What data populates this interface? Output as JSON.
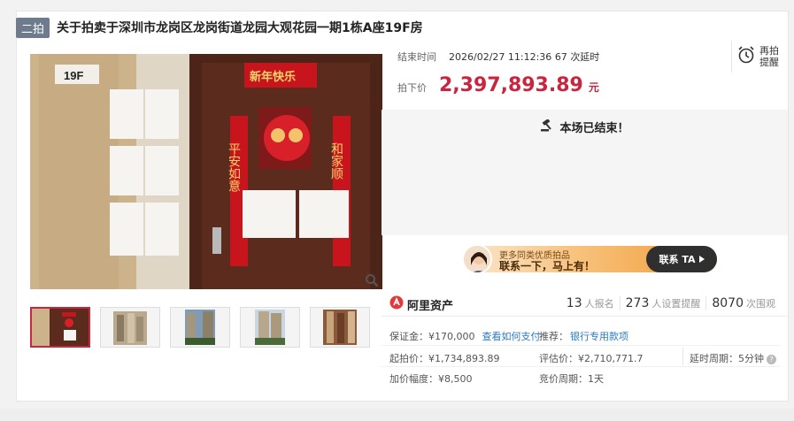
{
  "header": {
    "badge": "二拍",
    "title": "关于拍卖于深圳市龙岗区龙岗街道龙园大观花园一期1栋A座19F房"
  },
  "gallery": {
    "floor_sign": "19F",
    "couplet_top": "新年快乐",
    "couplet_left": "平安如意",
    "couplet_right": "和家顺",
    "thumbnail_count": 5
  },
  "auction": {
    "end_time_label": "结束时间",
    "end_time": "2026/02/27 11:12:36",
    "extensions": "67",
    "extensions_suffix": "次延时",
    "reminder_label": "再拍提醒",
    "price_label": "拍下价",
    "price": "2,397,893.89",
    "price_unit": "元",
    "ended_text": "本场已结束！"
  },
  "banner": {
    "line1": "更多同类优质拍品",
    "line2": "联系一下，马上有！",
    "button": "联系 TA"
  },
  "stats": {
    "brand": "阿里资产",
    "signups": "13",
    "signups_label": "人报名",
    "reminders": "273",
    "reminders_label": "人设置提醒",
    "views": "8070",
    "views_label": "次围观"
  },
  "details": {
    "deposit": "保证金：¥170,000",
    "pay_link": "查看如何支付",
    "recommend_label": "推荐：",
    "recommend_link": "银行专用款项",
    "start_price": "起拍价：¥1,734,893.89",
    "appraisal": "评估价：¥2,710,771.7",
    "delay_period": "延时周期：5分钟",
    "increment": "加价幅度：¥8,500",
    "bid_period": "竞价周期：1天"
  },
  "colors": {
    "accent": "#c9253f",
    "badge": "#6e7b8c",
    "link": "#2a7ac7"
  }
}
